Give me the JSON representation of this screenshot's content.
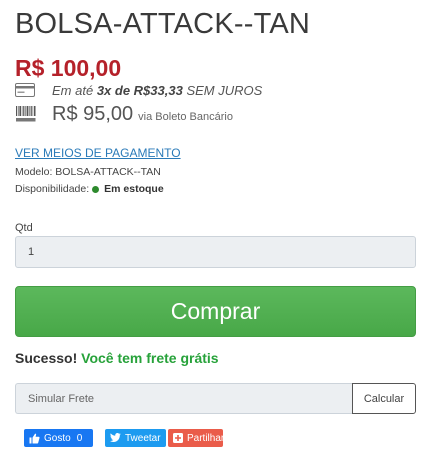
{
  "product": {
    "title": "BOLSA-ATTACK--TAN",
    "price": "R$ 100,00",
    "installment": {
      "prefix": "Em até",
      "detail": "3x de R$33,33",
      "suffix": "SEM JUROS"
    },
    "boleto": {
      "price": "R$ 95,00",
      "via": "via Boleto Bancário"
    },
    "payment_link": "VER MEIOS DE PAGAMENTO",
    "model_label": "Modelo:",
    "model_value": "BOLSA-ATTACK--TAN",
    "availability_label": "Disponibilidade:",
    "availability_value": "Em estoque"
  },
  "quantity": {
    "label": "Qtd",
    "value": "1"
  },
  "buy_button": "Comprar",
  "shipping": {
    "success": "Sucesso!",
    "message": "Você tem frete grátis",
    "placeholder": "Simular Frete",
    "button": "Calcular"
  },
  "social": {
    "facebook_label": "Gosto",
    "facebook_count": "0",
    "twitter_label": "Tweetar",
    "share_label": "Partilhar"
  },
  "colors": {
    "price": "#b5212a",
    "buy_button": "#5cb85c",
    "success": "#27a23a",
    "link": "#2a7ab8"
  }
}
